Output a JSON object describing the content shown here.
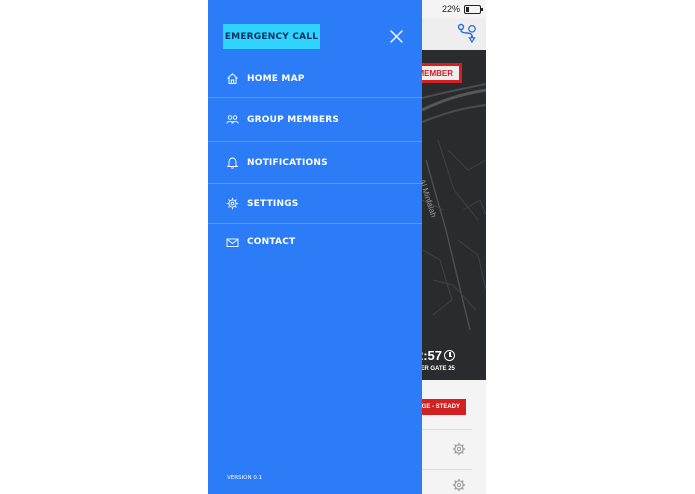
{
  "status_bar": {
    "battery_percent": "22%"
  },
  "background": {
    "member_button_label": "MEMBER",
    "map_road_label": "Al Minfalah",
    "timer_text": "2:57",
    "gate_text": "HER GATE 25",
    "steady_button_label": "GE - STEADY"
  },
  "drawer": {
    "emergency_call_label": "EMERGENCY CALL",
    "menu": [
      {
        "label": "HOME MAP",
        "icon": "home-icon"
      },
      {
        "label": "GROUP MEMBERS",
        "icon": "group-icon"
      },
      {
        "label": "NOTIFICATIONS",
        "icon": "bell-icon"
      },
      {
        "label": "SETTINGS",
        "icon": "gear-icon"
      },
      {
        "label": "CONTACT",
        "icon": "envelope-icon"
      }
    ],
    "version": "VERSION 0.1"
  },
  "colors": {
    "drawer_bg": "#2b7cf6",
    "emergency_bg": "#2fd3fc",
    "alert_red": "#d32020",
    "map_bg": "#2a2b2e"
  }
}
